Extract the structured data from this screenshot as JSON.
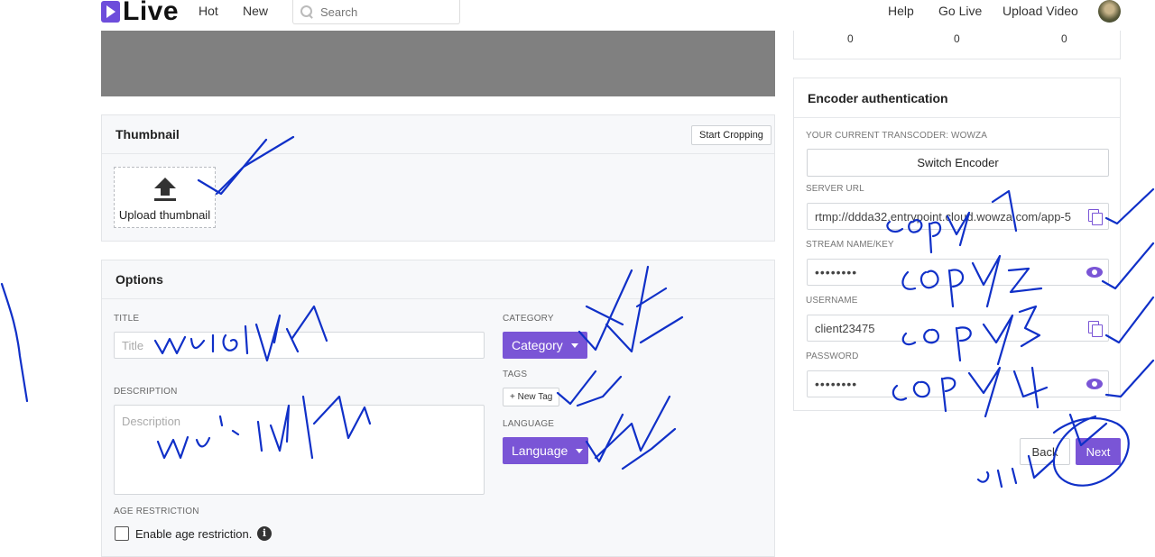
{
  "nav": {
    "logo_text": "Live",
    "links": [
      "Hot",
      "New"
    ],
    "search_placeholder": "Search",
    "right_links": [
      "Help",
      "Go Live",
      "Upload Video"
    ]
  },
  "stats": {
    "values": [
      "0",
      "0",
      "0"
    ]
  },
  "thumbnail": {
    "title": "Thumbnail",
    "crop_button": "Start Cropping",
    "upload_label": "Upload thumbnail"
  },
  "options": {
    "title": "Options",
    "title_label": "TITLE",
    "title_placeholder": "Title",
    "description_label": "DESCRIPTION",
    "description_placeholder": "Description",
    "category_label": "CATEGORY",
    "category_button": "Category",
    "tags_label": "TAGS",
    "new_tag_button": "+ New Tag",
    "language_label": "LANGUAGE",
    "language_button": "Language",
    "age_label": "AGE RESTRICTION",
    "age_checkbox_label": "Enable age restriction."
  },
  "encoder": {
    "title": "Encoder authentication",
    "transcoder_label": "YOUR CURRENT TRANSCODER: WOWZA",
    "switch_button": "Switch Encoder",
    "server_url_label": "SERVER URL",
    "server_url_value": "rtmp://ddda32.entrypoint.cloud.wowza.com/app-5",
    "stream_key_label": "STREAM NAME/KEY",
    "stream_key_value": "••••••••",
    "username_label": "USERNAME",
    "username_value": "client23475",
    "password_label": "PASSWORD",
    "password_value": "••••••••"
  },
  "footer": {
    "back_button": "Back",
    "next_button": "Next"
  },
  "colors": {
    "accent": "#7a55d6",
    "preview": "#808080",
    "annotation_ink": "#1030c8"
  }
}
